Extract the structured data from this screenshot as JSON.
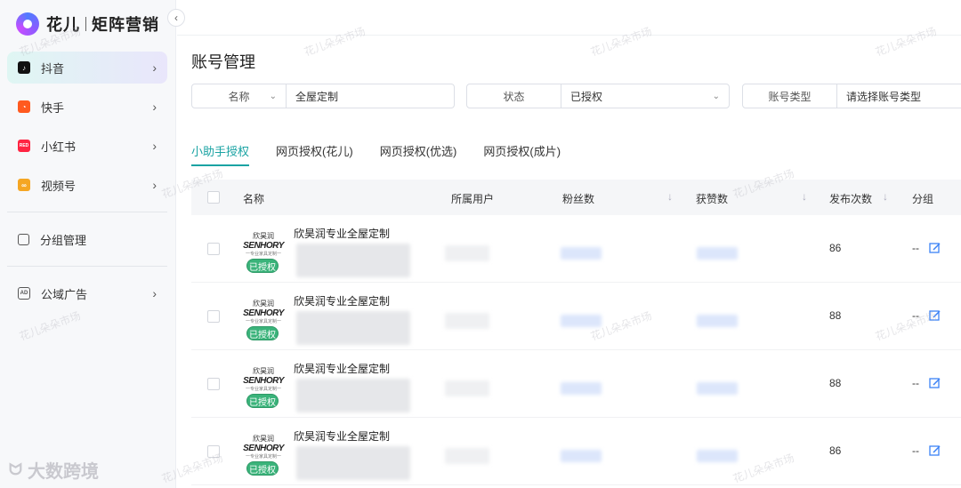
{
  "brand": {
    "name": "花儿",
    "product": "矩阵营销"
  },
  "sidebar": {
    "items": [
      {
        "label": "抖音",
        "icon": "douyin-icon",
        "color": "#111111",
        "active": true
      },
      {
        "label": "快手",
        "icon": "kuaishou-icon",
        "color": "#ff5a1f"
      },
      {
        "label": "小红书",
        "icon": "xiaohongshu-icon",
        "color": "#ff2442"
      },
      {
        "label": "视频号",
        "icon": "shipinhao-icon",
        "color": "#f5a623"
      }
    ],
    "group_manage": "分组管理",
    "ads": "公域广告"
  },
  "page": {
    "title": "账号管理"
  },
  "filters": {
    "name_label": "名称",
    "name_value": "全屋定制",
    "status_label": "状态",
    "status_value": "已授权",
    "type_label": "账号类型",
    "type_placeholder": "请选择账号类型"
  },
  "tabs": [
    "小助手授权",
    "网页授权(花儿)",
    "网页授权(优选)",
    "网页授权(成片)"
  ],
  "table": {
    "columns": {
      "name": "名称",
      "owner": "所属用户",
      "fans": "粉丝数",
      "likes": "获赞数",
      "posts": "发布次数",
      "group": "分组"
    },
    "rows": [
      {
        "name": "欣昊润专业全屋定制",
        "badge": "已授权",
        "posts": "86",
        "group": "--"
      },
      {
        "name": "欣昊润专业全屋定制",
        "badge": "已授权",
        "posts": "88",
        "group": "--"
      },
      {
        "name": "欣昊润专业全屋定制",
        "badge": "已授权",
        "posts": "88",
        "group": "--"
      },
      {
        "name": "欣昊润专业全屋定制",
        "badge": "已授权",
        "posts": "86",
        "group": "--"
      }
    ]
  },
  "avatar": {
    "cn": "欣昊润",
    "en": "SENHORY",
    "sub": "一专业家具定制一"
  },
  "watermark": "花儿朵朵市场",
  "corner_mark": "大数跨境",
  "colors": {
    "accent": "#1aa3a3",
    "badge": "#3ab37a",
    "edit": "#3b82f6"
  }
}
